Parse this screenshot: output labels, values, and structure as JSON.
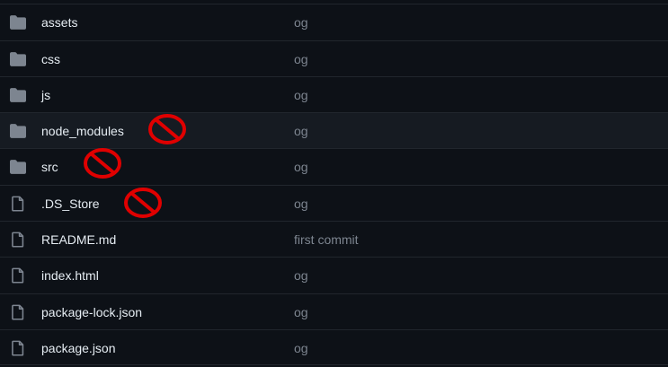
{
  "colors": {
    "background": "#0d1117",
    "row_hover": "#161b22",
    "border": "#21262d",
    "file_name": "#e6edf3",
    "commit_text": "#7d8590",
    "folder_icon": "#7d8590",
    "file_icon": "#7d8590",
    "prohibited_sign": "#e00000"
  },
  "files": [
    {
      "name": "assets",
      "type": "folder",
      "icon": "folder-icon",
      "commit": "og"
    },
    {
      "name": "css",
      "type": "folder",
      "icon": "folder-icon",
      "commit": "og"
    },
    {
      "name": "js",
      "type": "folder",
      "icon": "folder-icon",
      "commit": "og"
    },
    {
      "name": "node_modules",
      "type": "folder",
      "icon": "folder-icon",
      "commit": "og"
    },
    {
      "name": "src",
      "type": "folder",
      "icon": "folder-icon",
      "commit": "og"
    },
    {
      "name": ".DS_Store",
      "type": "file",
      "icon": "file-icon",
      "commit": "og"
    },
    {
      "name": "README.md",
      "type": "file",
      "icon": "file-icon",
      "commit": "first commit"
    },
    {
      "name": "index.html",
      "type": "file",
      "icon": "file-icon",
      "commit": "og"
    },
    {
      "name": "package-lock.json",
      "type": "file",
      "icon": "file-icon",
      "commit": "og"
    },
    {
      "name": "package.json",
      "type": "file",
      "icon": "file-icon",
      "commit": "og"
    }
  ],
  "annotations": [
    {
      "target": "node_modules",
      "icon": "prohibited-sign-icon"
    },
    {
      "target": "src",
      "icon": "prohibited-sign-icon"
    },
    {
      "target": ".DS_Store",
      "icon": "prohibited-sign-icon"
    }
  ]
}
